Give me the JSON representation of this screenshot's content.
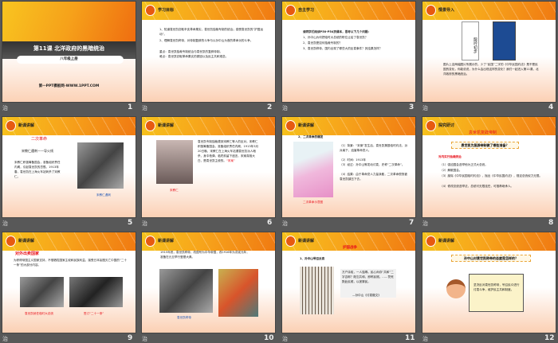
{
  "note_label": "治",
  "slides": [
    {
      "num": "1",
      "title": "第11课 北洋政府的黑暗统治",
      "subtitle": "八年级上册",
      "site": "第一PPT模板网-WWW.1PPT.COM"
    },
    {
      "num": "2",
      "header": "学习目标",
      "lines": [
        "1、知道袁世凯窃取辛亥革命果实，袁世凯独裁专制的统治；感受袁世凯的“护国运动”。",
        "2、理解袁世凯称帝，对帝制复辟的斗争与以孙中山为首的革命派的斗争。",
        "重点：袁世凯独裁专制统治与袁世凯的复辟帝制。",
        "难点：袁世凯窃取革命果实的原因以及民主共和观念。"
      ]
    },
    {
      "num": "3",
      "header": "自主学习",
      "intro": "请同学们阅读P50-P54页课本，思考以下几个问题：",
      "lines": [
        "1、孙中山为何把临时大总统的职位让给了袁世凯？",
        "2、袁世凯是如何独裁专制的？",
        "3、袁世凯称帝，国内出现了哪些大的反袁事件？其结果怎样？"
      ]
    },
    {
      "num": "4",
      "header": "情景导入",
      "book": "龍吟初步",
      "text": "图片上这两幅图片所展示的，少了“民国”二字的《中华民国约法》是不是民国的变化，你能说说，为什么会出现这样的变化？我们一起进入第11课，北洋政府的黑暗统治。"
    },
    {
      "num": "5",
      "header": "新课讲解",
      "heading": "二次革命",
      "sub": "宋教仁遇刺——导火线",
      "text": "宋教仁积极筹备国会，准备组织责任内阁，引起袁世凯的忌恨。1913年春，袁世凯在上海火车站刺杀了宋教仁。",
      "caption": "宋教仁遇刺"
    },
    {
      "num": "6",
      "header": "新课讲解",
      "text": "袁世凯专制独裁遭到宋教仁等人的反对。宋教仁积极筹备国会，准备组织责任内阁，1913年3月20日晚，宋教仁在上海火车站遭袁世凯派人暗杀，身中枪弹，临终前留下遗言，宋案真相大白，是袁世凯主使的。",
      "hl": "“宋案”",
      "caption": "宋教仁"
    },
    {
      "num": "7",
      "header": "新课讲解",
      "heading": "2、二次革命的爆发",
      "lines": [
        "（1）背景：“宋案”发生后，袁世凯撕毁临时约法，派兵南下，迫害革命党人。",
        "（2）时间：1913年",
        "（3）经过：孙中山等发动讨袁，史称“二次革命”。",
        "（4）结果：由于革命党人力量涣散，二次革命很快被袁世凯镇压下去。"
      ],
      "caption": "二次革命示意图"
    },
    {
      "num": "8",
      "header": "探究研讨",
      "heading": "袁世凯复辟帝制",
      "question": "袁世凯为复辟帝制做了哪些准备？",
      "sub": "对内实行独裁统治",
      "lines": [
        "（1）强迫国会选举他为正式大总统。",
        "（2）解散国会。",
        "（3）废除《中华民国临时约法》，抛出《中华民国约法》，规定总统权力无限。",
        "（4）修改总统选举法，总统可无限连任，可推荐继承人。"
      ]
    },
    {
      "num": "9",
      "header": "新课讲解",
      "heading": "对外出卖国家",
      "text": "为获得帝国主义国家支持，不惜牺牲国家主权和民族利益，接受日本妄图灭亡中国的“二十一条”的大部分内容。",
      "captions": [
        "袁世凯就任临时大总统",
        "签订“二十一条”"
      ]
    },
    {
      "num": "10",
      "header": "新课讲解",
      "text": "1915年底，袁世凯称帝，改国号为中华帝国，改1916年为洪宪元年，准备在元旦举行登基大典。",
      "caption": "袁世凯称帝"
    },
    {
      "num": "11",
      "header": "新课讲解",
      "heading": "护国战争",
      "sub": "1、孙中山号召反袁",
      "quote": "万户涂炭，一人独尊。民心尚存“共和”二字否耶？既忘共和，即称民贼。……誓死戮此民贼，以拯黎民。",
      "source": "—孙中山《讨袁檄文》"
    },
    {
      "num": "12",
      "header": "新课讲解",
      "question": "孙中山对袁世凯称帝的态度是怎样的？",
      "note": "坚决反对袁世凯称帝，号召民众进行讨袁斗争，维护民主共和制度。"
    }
  ]
}
